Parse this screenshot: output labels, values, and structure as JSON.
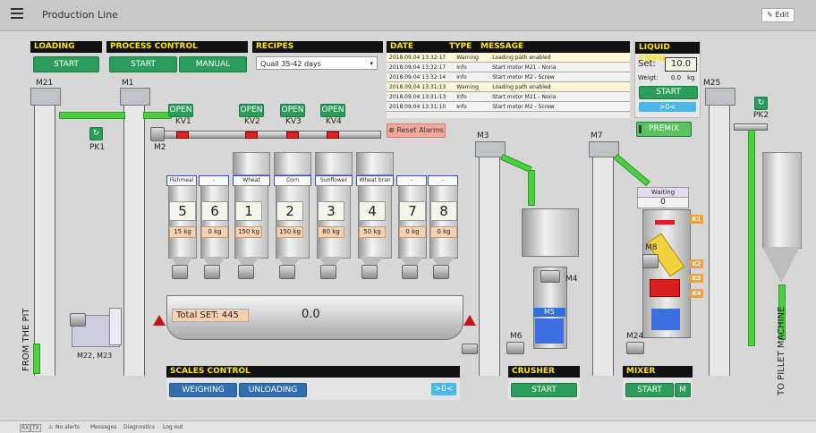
{
  "app": {
    "title": "Production Line",
    "edit_label": "Edit"
  },
  "loading": {
    "title": "LOADING",
    "start": "START"
  },
  "process": {
    "title": "PROCESS CONTROL",
    "start": "START",
    "manual": "MANUAL"
  },
  "recipes": {
    "title": "RECIPES",
    "selected": "Quail 35-42 days"
  },
  "log": {
    "headers": [
      "DATE",
      "TYPE",
      "MESSAGE"
    ],
    "rows": [
      {
        "date": "2018.09.04 13:32:17",
        "type": "Warning",
        "message": "Loading path enabled"
      },
      {
        "date": "2018.09.04 13:32:17",
        "type": "Info",
        "message": "Start motor M21 - Noria"
      },
      {
        "date": "2018.09.04 13:32:14",
        "type": "Info",
        "message": "Start motor M2 - Screw"
      },
      {
        "date": "2018.09.04 13:31:13",
        "type": "Warning",
        "message": "Loading path enabled"
      },
      {
        "date": "2018.09.04 13:31:13",
        "type": "Info",
        "message": "Start motor M21 - Noria"
      },
      {
        "date": "2018.09.04 13:31:10",
        "type": "Info",
        "message": "Start motor M2 - Screw"
      }
    ],
    "reset": "Reset Alarms"
  },
  "liquid": {
    "title": "LIQUID CMPN.",
    "set_label": "Set:",
    "set_value": "10.0",
    "weight_label": "Weigt:",
    "weight_value": "0.0",
    "weight_unit": "kg",
    "start": "START",
    "zero": ">0<",
    "premix": "PREMIX"
  },
  "labels": {
    "m21": "M21",
    "m1": "M1",
    "m2": "M2",
    "m3": "M3",
    "m4": "M4",
    "m5": "M5",
    "m6": "M6",
    "m7": "M7",
    "m8": "M8",
    "m24": "M24",
    "m25": "M25",
    "pk1": "PK1",
    "pk2": "PK2",
    "m22m23": "M22, M23",
    "from_pit": "FROM THE PIT",
    "to_pillet": "TO PILLET MACHINE"
  },
  "valves": [
    {
      "open": "OPEN",
      "name": "KV1"
    },
    {
      "open": "OPEN",
      "name": "KV2"
    },
    {
      "open": "OPEN",
      "name": "KV3"
    },
    {
      "open": "OPEN",
      "name": "KV4"
    }
  ],
  "silos": [
    {
      "name": "Fishmeal",
      "num": "5",
      "kg": "15 kg"
    },
    {
      "name": "-",
      "num": "6",
      "kg": "0 kg"
    },
    {
      "name": "Wheat",
      "num": "1",
      "kg": "150 kg"
    },
    {
      "name": "Corn",
      "num": "2",
      "kg": "150 kg"
    },
    {
      "name": "Sunflower",
      "num": "3",
      "kg": "80 kg"
    },
    {
      "name": "Wheat bran",
      "num": "4",
      "kg": "50 kg"
    },
    {
      "name": "-",
      "num": "7",
      "kg": "0 kg"
    },
    {
      "name": "-",
      "num": "8",
      "kg": "0 kg"
    }
  ],
  "scale": {
    "total_set": "Total SET: 445",
    "value": "0.0"
  },
  "scales_control": {
    "title": "SCALES CONTROL",
    "weighing": "WEIGHING",
    "unloading": "UNLOADING",
    "zero": ">0<"
  },
  "crusher": {
    "title": "CRUSHER",
    "start": "START"
  },
  "mixer": {
    "title": "MIXER",
    "start": "START",
    "m": "M",
    "status": "Waiting",
    "count": "0",
    "badges": [
      "K1",
      "K2",
      "K3",
      "K4"
    ]
  },
  "statusbar": {
    "rx": "RX",
    "tx": "TX",
    "alerts": "No alerts",
    "messages": "Messages",
    "diagnostics": "Diagnostics",
    "logout": "Log out"
  },
  "colors": {
    "accent_green": "#2a9d5a",
    "accent_blue": "#2f6fb0",
    "header_yellow": "#ffe600",
    "warning_row": "#fff6d8",
    "flow_green": "#4bd13f"
  }
}
